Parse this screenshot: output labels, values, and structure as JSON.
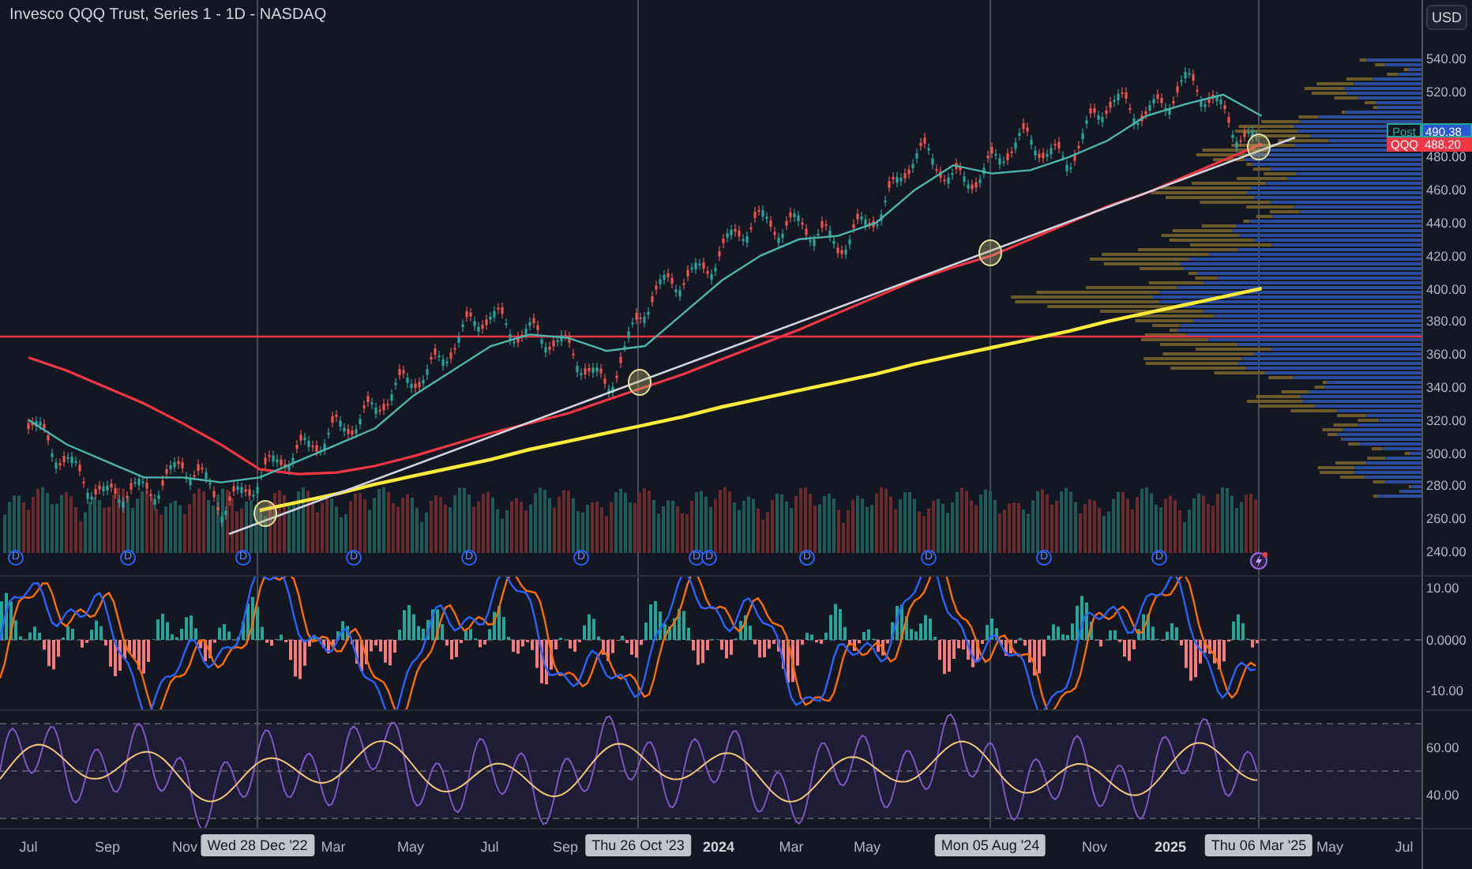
{
  "chart": {
    "title": "Invesco QQQ Trust, Series 1 - 1D - NASDAQ",
    "currency_button": "USD",
    "price_axis": {
      "ticks": [
        "540.00",
        "520.00",
        "480.00",
        "460.00",
        "440.00",
        "420.00",
        "400.00",
        "380.00",
        "360.00",
        "340.00",
        "320.00",
        "300.00",
        "280.00",
        "260.00",
        "240.00"
      ],
      "tags": [
        {
          "kind": "post",
          "name": "Post",
          "value": "490.38",
          "color": "#26a69a"
        },
        {
          "kind": "last",
          "name": "QQQ",
          "value": "488.20",
          "color": "#f23645"
        }
      ]
    },
    "dividends": [
      {
        "label": "D"
      },
      {
        "label": "D"
      },
      {
        "label": "D"
      },
      {
        "label": "D"
      },
      {
        "label": "D"
      },
      {
        "label": "D"
      },
      {
        "label": "D"
      },
      {
        "label": "D"
      },
      {
        "label": "D"
      },
      {
        "label": "D"
      },
      {
        "label": "D"
      },
      {
        "label": "D"
      }
    ],
    "macd_axis": {
      "ticks": [
        "10.00",
        "0.0000",
        "-10.00"
      ]
    },
    "rsi_axis": {
      "ticks": [
        "60.00",
        "40.00"
      ]
    },
    "time_axis": {
      "labels": [
        {
          "text": "Jul",
          "kind": "month"
        },
        {
          "text": "Sep",
          "kind": "month"
        },
        {
          "text": "Nov",
          "kind": "month"
        },
        {
          "text": "Wed 28 Dec '22",
          "kind": "crosshair"
        },
        {
          "text": "Mar",
          "kind": "month"
        },
        {
          "text": "May",
          "kind": "month"
        },
        {
          "text": "Jul",
          "kind": "month"
        },
        {
          "text": "Sep",
          "kind": "month"
        },
        {
          "text": "Thu 26 Oct '23",
          "kind": "crosshair"
        },
        {
          "text": "2024",
          "kind": "year"
        },
        {
          "text": "Mar",
          "kind": "month"
        },
        {
          "text": "May",
          "kind": "month"
        },
        {
          "text": "Mon 05 Aug '24",
          "kind": "crosshair"
        },
        {
          "text": "Nov",
          "kind": "month"
        },
        {
          "text": "2025",
          "kind": "year"
        },
        {
          "text": "Thu 06 Mar '25",
          "kind": "crosshair"
        },
        {
          "text": "May",
          "kind": "month"
        },
        {
          "text": "Jul",
          "kind": "month"
        }
      ]
    }
  }
}
